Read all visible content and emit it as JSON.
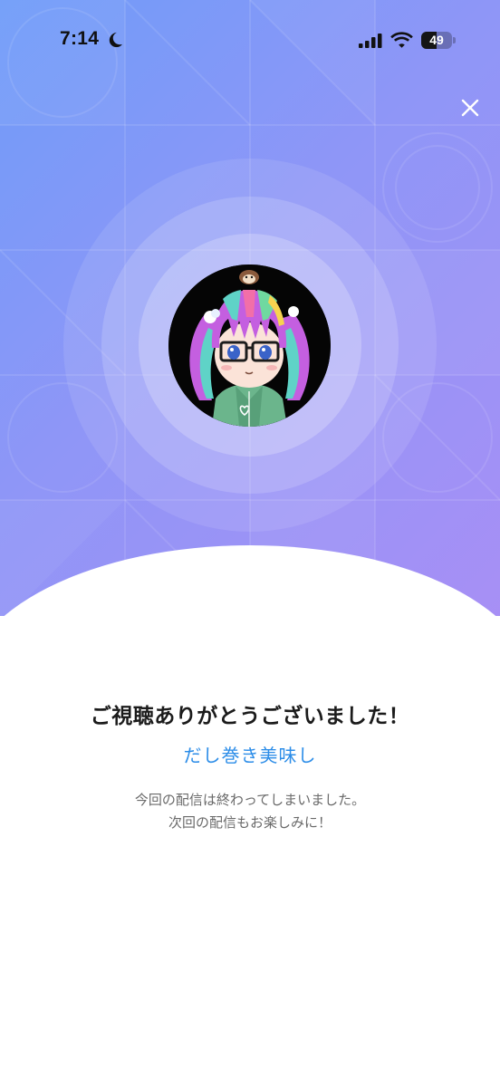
{
  "status_bar": {
    "time": "7:14",
    "battery_level": "49",
    "battery_fraction": 0.49,
    "icons": [
      "moon-icon",
      "cellular-signal-icon",
      "wifi-icon",
      "battery-icon"
    ]
  },
  "header": {
    "close_icon": "close-icon"
  },
  "hero": {
    "avatar_icon": "streamer-avatar",
    "gradient_start": "#6f9cf9",
    "gradient_end": "#a88ff5"
  },
  "content": {
    "title": "ご視聴ありがとうございました！",
    "streamer_name": "だし巻き美味し",
    "message_line1": "今回の配信は終わってしまいました。",
    "message_line2": "次回の配信もお楽しみに！"
  },
  "colors": {
    "accent": "#2c8de8",
    "title_text": "#1b1b1b",
    "body_text": "#6a6a6a"
  }
}
